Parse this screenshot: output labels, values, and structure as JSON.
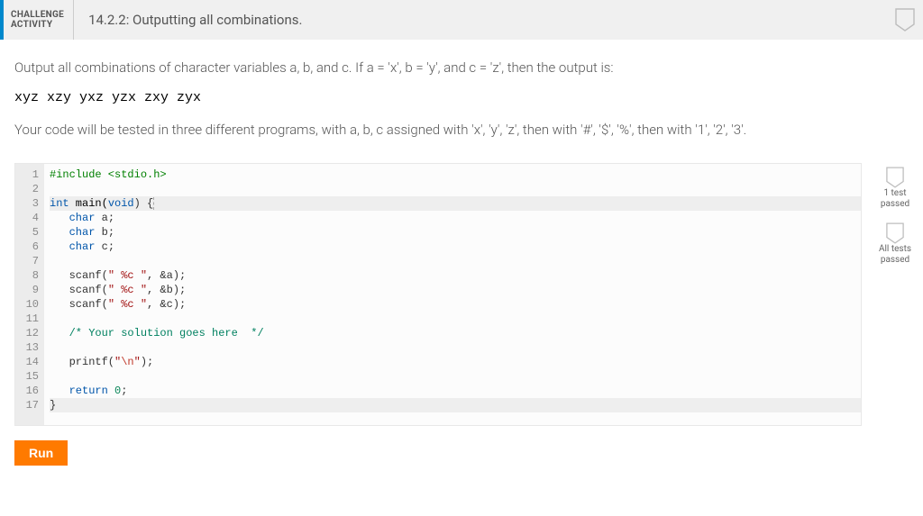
{
  "header": {
    "label_line1": "CHALLENGE",
    "label_line2": "ACTIVITY",
    "title": "14.2.2: Outputting all combinations."
  },
  "prompt": {
    "line1": "Output all combinations of character variables a, b, and c. If a = 'x', b = 'y', and c = 'z', then the output is:",
    "sample_output": "xyz xzy yxz yzx zxy zyx",
    "line2": "Your code will be tested in three different programs, with a, b, c assigned with 'x', 'y', 'z', then with '#', '$', '%', then with '1', '2', '3'."
  },
  "editor": {
    "line_count": 17,
    "code": {
      "l1_include": "#include <stdio.h>",
      "l3_kw_int": "int",
      "l3_fn": " main(",
      "l3_kw_void": "void",
      "l3_tail": ") {",
      "l4_kw_char": "char",
      "l4_a": " a;",
      "l5_kw_char": "char",
      "l5_b": " b;",
      "l6_kw_char": "char",
      "l6_c": " c;",
      "l8_scanf": "   scanf(",
      "l8_str": "\" %c \"",
      "l8_tail": ", &a);",
      "l9_scanf": "   scanf(",
      "l9_str": "\" %c \"",
      "l9_tail": ", &b);",
      "l10_scanf": "   scanf(",
      "l10_str": "\" %c \"",
      "l10_tail": ", &c);",
      "l12_cmt": "   /* Your solution goes here  */",
      "l14_printf": "   printf(",
      "l14_str_open": "\"",
      "l14_esc": "\\n",
      "l14_str_close": "\"",
      "l14_tail": ");",
      "l16_kw_return": "return",
      "l16_sp": " ",
      "l16_num": "0",
      "l16_tail": ";",
      "l17_brace": "}"
    }
  },
  "status": {
    "one_test_l1": "1 test",
    "one_test_l2": "passed",
    "all_tests_l1": "All tests",
    "all_tests_l2": "passed"
  },
  "actions": {
    "run": "Run"
  }
}
